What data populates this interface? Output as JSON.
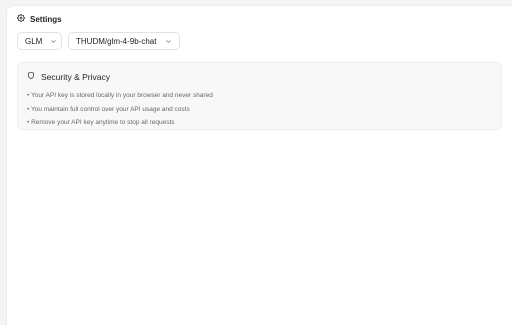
{
  "settings": {
    "title": "Settings",
    "icon": "gear-icon"
  },
  "selects": {
    "provider": {
      "value": "GLM",
      "icon": "chevron-down-icon"
    },
    "model": {
      "value": "THUDM/glm-4-9b-chat",
      "icon": "chevron-down-icon"
    }
  },
  "security": {
    "icon": "shield-icon",
    "title": "Security & Privacy",
    "items": [
      "• Your API key is stored locally in your browser and never shared",
      "• You maintain full control over your API usage and costs",
      "• Remove your API key anytime to stop all requests"
    ]
  }
}
